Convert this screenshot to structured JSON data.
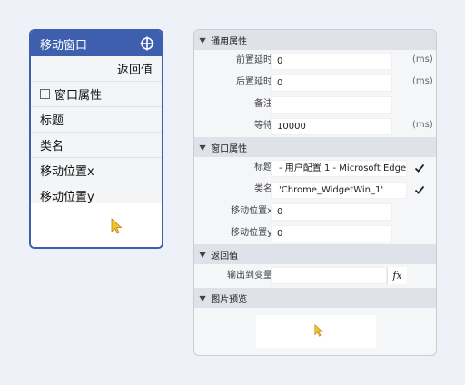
{
  "node": {
    "title": "移动窗口",
    "return_value_label": "返回值",
    "group_label": "窗口属性",
    "rows": [
      "标题",
      "类名",
      "移动位置x",
      "移动位置y"
    ]
  },
  "panel": {
    "general": {
      "title": "通用属性",
      "pre_delay_label": "前置延时",
      "pre_delay_value": "0",
      "pre_delay_unit": "(ms)",
      "post_delay_label": "后置延时",
      "post_delay_value": "0",
      "post_delay_unit": "(ms)",
      "note_label": "备注",
      "note_value": "",
      "wait_label": "等待",
      "wait_value": "10000",
      "wait_unit": "(ms)"
    },
    "window": {
      "title": "窗口属性",
      "title_label": "标题",
      "title_value": "- 用户配置 1 - Microsoft Edge'",
      "class_label": "类名",
      "class_value": "'Chrome_WidgetWin_1'",
      "move_x_label": "移动位置x",
      "move_x_value": "0",
      "move_y_label": "移动位置y",
      "move_y_value": "0"
    },
    "return": {
      "title": "返回值",
      "output_label": "输出到变量",
      "output_value": "",
      "fx_label": "fx"
    },
    "preview": {
      "title": "图片预览"
    }
  },
  "colors": {
    "accent": "#3d5fae",
    "cursor": "#f2c233"
  },
  "icons": {
    "node_header": "crosshair-icon",
    "cursor": "cursor-icon",
    "collapse": "minus-box-icon",
    "section": "chevron-down-icon",
    "check": "checkmark-icon"
  }
}
